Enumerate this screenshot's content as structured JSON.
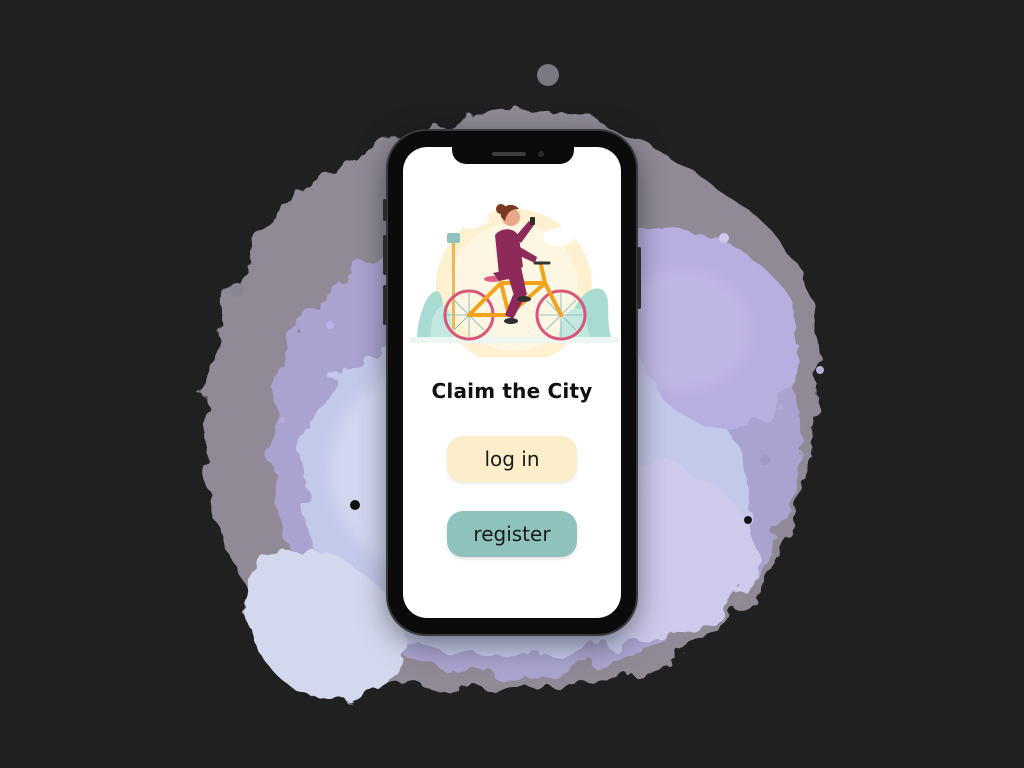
{
  "app": {
    "title": "Claim the City"
  },
  "buttons": {
    "login_label": "log in",
    "register_label": "register"
  },
  "illustration": {
    "subject": "woman-riding-bicycle-icon"
  },
  "colors": {
    "background": "#202020",
    "splash_purple": "#b9aee0",
    "splash_gray": "#8f8a95",
    "login_button": "#fdeecb",
    "register_button": "#8ec3bd",
    "rider_outfit": "#8e2a5a",
    "bike_frame": "#f3a21c",
    "wheel_rim": "#d9557a",
    "foliage": "#a8dcd3",
    "sun_glow": "#fdf1cf"
  }
}
